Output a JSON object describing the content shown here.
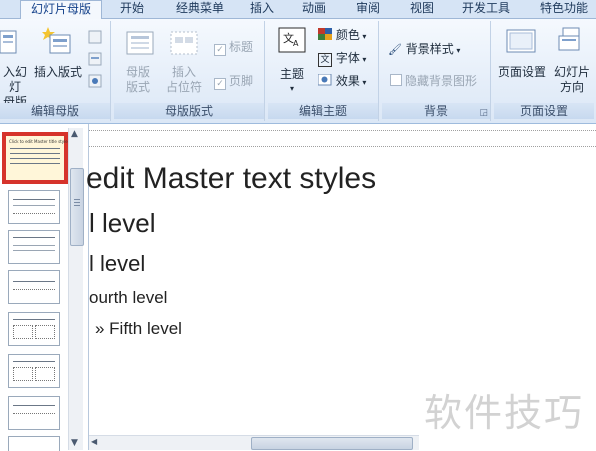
{
  "tabs": {
    "slide_master": "幻灯片母版",
    "home": "开始",
    "classic_menu": "经典菜单",
    "insert": "插入",
    "animation": "动画",
    "review": "审阅",
    "view": "视图",
    "developer": "开发工具",
    "special": "特色功能"
  },
  "ribbon": {
    "edit_master": {
      "label": "编辑母版",
      "insert_slide_master_line1": "入幻灯",
      "insert_slide_master_line2": "母版",
      "insert_layout": "插入版式"
    },
    "master_layout": {
      "label": "母版版式",
      "master_layout_line1": "母版",
      "master_layout_line2": "版式",
      "insert_placeholder_line1": "插入",
      "insert_placeholder_line2": "占位符",
      "title_checkbox": "标题",
      "footer_checkbox": "页脚"
    },
    "edit_theme": {
      "label": "编辑主题",
      "themes": "主题",
      "colors": "颜色",
      "fonts": "字体",
      "effects": "效果"
    },
    "background": {
      "label": "背景",
      "background_styles": "背景样式",
      "hide_background_graphics": "隐藏背景图形"
    },
    "page_setup": {
      "label": "页面设置",
      "page_setup": "页面设置",
      "orientation_line1": "幻灯片",
      "orientation_line2": "方向"
    }
  },
  "thumbnail_title_text": "Click to edit Master title style",
  "slide": {
    "level1": "edit Master text styles",
    "level2": "l level",
    "level3": "l level",
    "level4": "ourth level",
    "level5": "»  Fifth level"
  },
  "watermark": "软件技巧",
  "colors": {
    "accent_red": "#d6332b",
    "ribbon_blue": "#dbe7f6"
  }
}
